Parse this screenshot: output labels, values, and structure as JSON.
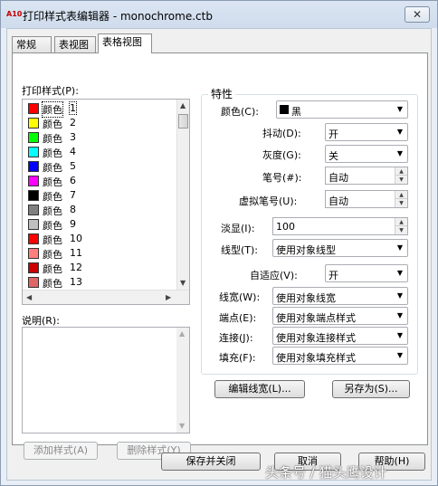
{
  "window": {
    "app_icon": "A10",
    "title": "打印样式表编辑器 - monochrome.ctb",
    "close_glyph": "✕"
  },
  "tabs": [
    {
      "label": "常规"
    },
    {
      "label": "表视图"
    },
    {
      "label": "表格视图",
      "active": true
    }
  ],
  "styles_list": {
    "label": "打印样式(P):",
    "items": [
      {
        "name": "颜色",
        "num": "1",
        "color": "#ff0000"
      },
      {
        "name": "颜色",
        "num": "2",
        "color": "#ffff00"
      },
      {
        "name": "颜色",
        "num": "3",
        "color": "#00ff00"
      },
      {
        "name": "颜色",
        "num": "4",
        "color": "#00ffff"
      },
      {
        "name": "颜色",
        "num": "5",
        "color": "#0000ff"
      },
      {
        "name": "颜色",
        "num": "6",
        "color": "#ff00ff"
      },
      {
        "name": "颜色",
        "num": "7",
        "color": "#000000"
      },
      {
        "name": "颜色",
        "num": "8",
        "color": "#808080"
      },
      {
        "name": "颜色",
        "num": "9",
        "color": "#c0c0c0"
      },
      {
        "name": "颜色",
        "num": "10",
        "color": "#ff0000"
      },
      {
        "name": "颜色",
        "num": "11",
        "color": "#ff7f7f"
      },
      {
        "name": "颜色",
        "num": "12",
        "color": "#cc0000"
      },
      {
        "name": "颜色",
        "num": "13",
        "color": "#e06666"
      }
    ]
  },
  "description": {
    "label": "说明(R):"
  },
  "buttons": {
    "add_style": "添加样式(A)",
    "delete_style": "删除样式(Y)",
    "edit_lineweights": "编辑线宽(L)...",
    "save_as": "另存为(S)...",
    "save_close": "保存并关闭",
    "cancel": "取消",
    "help": "帮助(H)"
  },
  "properties": {
    "title": "特性",
    "color": {
      "label": "颜色(C):",
      "value": "黑"
    },
    "dither": {
      "label": "抖动(D):",
      "value": "开"
    },
    "grayscale": {
      "label": "灰度(G):",
      "value": "关"
    },
    "pen": {
      "label": "笔号(#):",
      "value": "自动"
    },
    "virtual_pen": {
      "label": "虚拟笔号(U):",
      "value": "自动"
    },
    "screening": {
      "label": "淡显(I):",
      "value": "100"
    },
    "linetype": {
      "label": "线型(T):",
      "value": "使用对象线型"
    },
    "adaptive": {
      "label": "自适应(V):",
      "value": "开"
    },
    "lineweight": {
      "label": "线宽(W):",
      "value": "使用对象线宽"
    },
    "line_end": {
      "label": "端点(E):",
      "value": "使用对象端点样式"
    },
    "line_join": {
      "label": "连接(J):",
      "value": "使用对象连接样式"
    },
    "fill": {
      "label": "填充(F):",
      "value": "使用对象填充样式"
    }
  },
  "watermark": "头条号 / 猫头鹰设计"
}
